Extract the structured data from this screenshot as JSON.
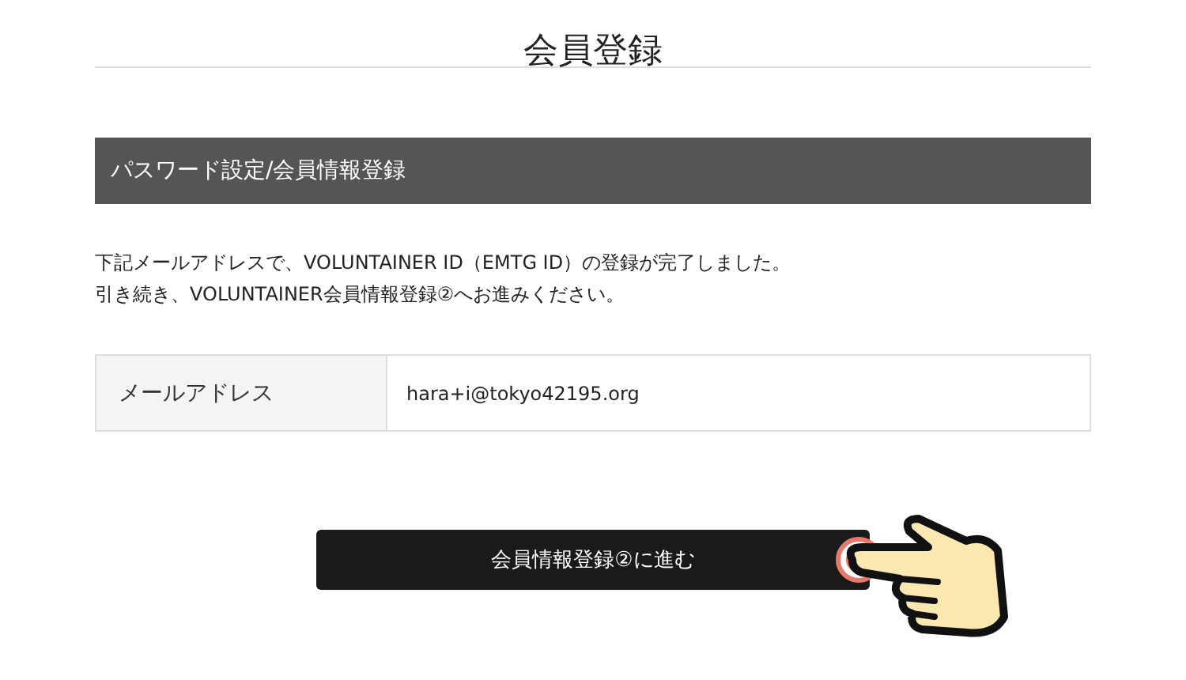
{
  "page_title": "会員登録",
  "section_header": "パスワード設定/会員情報登録",
  "message_lines": [
    "下記メールアドレスで、VOLUNTAINER ID（EMTG ID）の登録が完了しました。",
    "引き続き、VOLUNTAINER会員情報登録②へお進みください。"
  ],
  "fields": [
    {
      "label": "メールアドレス",
      "value": "hara+i@tokyo42195.org"
    }
  ],
  "submit_button": "会員情報登録②に進む"
}
